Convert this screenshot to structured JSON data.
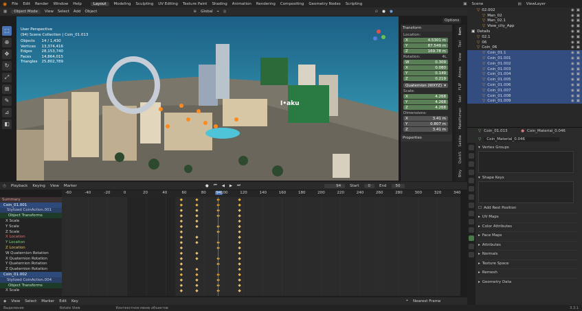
{
  "menu": {
    "items": [
      "File",
      "Edit",
      "Render",
      "Window",
      "Help"
    ],
    "workspaces": [
      "Layout",
      "Modeling",
      "Sculpting",
      "UV Editing",
      "Texture Paint",
      "Shading",
      "Animation",
      "Rendering",
      "Compositing",
      "Geometry Nodes",
      "Scripting"
    ],
    "active_workspace": "Layout",
    "scene": "Scene",
    "view_layer": "ViewLayer"
  },
  "viewport_header": {
    "mode": "Object Mode",
    "items": [
      "View",
      "Select",
      "Add",
      "Object"
    ],
    "transform": "Global",
    "options": "Options"
  },
  "viewport_info": {
    "perspective": "User Perspective",
    "collection": "(94) Scene Collection | Coin_01.013",
    "stats": [
      {
        "label": "Objects",
        "value": "14 / 1,430"
      },
      {
        "label": "Vertices",
        "value": "13,374,416"
      },
      {
        "label": "Edges",
        "value": "28,153,740"
      },
      {
        "label": "Faces",
        "value": "14,864,015"
      },
      {
        "label": "Triangles",
        "value": "25,802,789"
      }
    ],
    "sign_text": "I•aku"
  },
  "transform_panel": {
    "tab": "Transform",
    "location_label": "Location:",
    "location": [
      {
        "axis": "X",
        "value": "4.5301 m"
      },
      {
        "axis": "Y",
        "value": "87.549 m"
      },
      {
        "axis": "Z",
        "value": "169.78 m"
      }
    ],
    "rotation_label": "Rotation:",
    "rotation_mode_short": "4L",
    "rotation": [
      {
        "axis": "W",
        "value": "0.309"
      },
      {
        "axis": "X",
        "value": "0.080"
      },
      {
        "axis": "Y",
        "value": "0.149"
      },
      {
        "axis": "Z",
        "value": "0.219"
      }
    ],
    "rotation_mode": "Quaternion (WXYZ)",
    "scale_label": "Scale:",
    "scale": [
      {
        "axis": "X",
        "value": "4.268"
      },
      {
        "axis": "Y",
        "value": "4.268"
      },
      {
        "axis": "Z",
        "value": "4.268"
      }
    ],
    "dimensions_label": "Dimensions:",
    "dimensions": [
      {
        "axis": "X",
        "value": "3.41 m"
      },
      {
        "axis": "Y",
        "value": "0.807 m"
      },
      {
        "axis": "Z",
        "value": "3.41 m"
      }
    ],
    "properties": "Properties"
  },
  "side_tabs": [
    "Item",
    "Tool",
    "View",
    "Atmos",
    "FLIP",
    "Skel",
    "MakeHuman",
    "Sakiba",
    "QuickS",
    "Bfxy"
  ],
  "outliner": {
    "rows": [
      {
        "indent": 1,
        "name": "02.002",
        "sel": false
      },
      {
        "indent": 2,
        "name": "Man_02",
        "sel": false
      },
      {
        "indent": 2,
        "name": "Man_02.1",
        "sel": false
      },
      {
        "indent": 2,
        "name": "View_city_App",
        "sel": false
      },
      {
        "indent": 0,
        "name": "Details",
        "sel": false
      },
      {
        "indent": 1,
        "name": "02.1",
        "sel": false
      },
      {
        "indent": 1,
        "name": "06",
        "sel": false
      },
      {
        "indent": 1,
        "name": "Coin_06",
        "sel": false
      },
      {
        "indent": 2,
        "name": "Coin_01.1",
        "sel": true
      },
      {
        "indent": 2,
        "name": "Coin_01.001",
        "sel": true
      },
      {
        "indent": 2,
        "name": "Coin_01.002",
        "sel": true
      },
      {
        "indent": 2,
        "name": "Coin_01.003",
        "sel": true
      },
      {
        "indent": 2,
        "name": "Coin_01.004",
        "sel": true
      },
      {
        "indent": 2,
        "name": "Coin_01.005",
        "sel": true
      },
      {
        "indent": 2,
        "name": "Coin_01.006",
        "sel": true
      },
      {
        "indent": 2,
        "name": "Coin_01.007",
        "sel": true
      },
      {
        "indent": 2,
        "name": "Coin_01.008",
        "sel": true
      },
      {
        "indent": 2,
        "name": "Coin_01.009",
        "sel": true
      }
    ]
  },
  "properties_editor": {
    "object": "Coin_01.013",
    "material_slot": "Coin_Material_0.046",
    "material": "Coin_Material_0.046",
    "sections": [
      "Vertex Groups",
      "Shape Keys"
    ],
    "add_rest_position": "Add Rest Position",
    "collapsed": [
      "UV Maps",
      "Color Attributes",
      "Face Maps",
      "Attributes",
      "Normals",
      "Texture Space",
      "Remesh",
      "Geometry Data"
    ]
  },
  "dopesheet": {
    "menus": [
      "Playback",
      "Keying",
      "View",
      "Marker"
    ],
    "current_frame": "94",
    "start_label": "Start",
    "start": "0",
    "end_label": "End",
    "end": "50",
    "ruler": [
      "-60",
      "-40",
      "-20",
      "0",
      "20",
      "40",
      "60",
      "80",
      "94",
      "100",
      "120",
      "140",
      "160",
      "180",
      "200",
      "220",
      "240",
      "260",
      "280",
      "300",
      "320",
      "340"
    ],
    "channels": [
      {
        "type": "sum",
        "name": "Summary"
      },
      {
        "type": "obj",
        "name": "Coin_01.001"
      },
      {
        "type": "act",
        "name": "Stylized CoinAction.001"
      },
      {
        "type": "grp",
        "name": "Object Transforms"
      },
      {
        "type": "ch",
        "name": "X Scale"
      },
      {
        "type": "ch",
        "name": "Y Scale"
      },
      {
        "type": "ch",
        "name": "Z Scale"
      },
      {
        "type": "red",
        "name": "X Location"
      },
      {
        "type": "grn",
        "name": "Y Location"
      },
      {
        "type": "yel",
        "name": "Z Location"
      },
      {
        "type": "ch",
        "name": "W Quaternion Rotation"
      },
      {
        "type": "ch",
        "name": "X Quaternion Rotation"
      },
      {
        "type": "ch",
        "name": "Y Quaternion Rotation"
      },
      {
        "type": "ch",
        "name": "Z Quaternion Rotation"
      },
      {
        "type": "obj",
        "name": "Coin_01.002"
      },
      {
        "type": "act",
        "name": "Stylized CoinAction.004"
      },
      {
        "type": "grp",
        "name": "Object Transforms"
      },
      {
        "type": "ch",
        "name": "X Scale"
      }
    ],
    "footer_menus": [
      "View",
      "Select",
      "Marker",
      "Edit",
      "Key"
    ],
    "interpolation": "Nearest Frame"
  },
  "status_bar": [
    "Выделение",
    "Rotate View",
    "Контекстное меню объектов"
  ],
  "version": "3.3.1"
}
